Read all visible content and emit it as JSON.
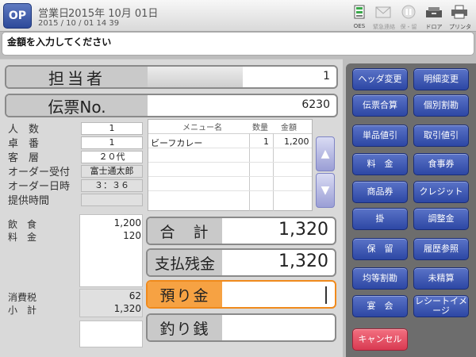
{
  "header": {
    "op_label": "OP",
    "biz_day_label": "営業日",
    "biz_date": "2015年 10月 01日",
    "clock": "2015 / 10 / 01  14  39",
    "status_icons": [
      {
        "name": "oes-icon",
        "label": "OES"
      },
      {
        "name": "mail-icon",
        "label": "緊急連絡"
      },
      {
        "name": "pause-icon",
        "label": "保・留"
      },
      {
        "name": "drawer-icon",
        "label": "ドロア"
      },
      {
        "name": "printer-icon",
        "label": "プリンタ"
      }
    ]
  },
  "message": "金額を入力してください",
  "staff": {
    "label": "担当者",
    "value": "1"
  },
  "slip": {
    "label": "伝票No.",
    "value": "6230"
  },
  "info": [
    {
      "label": "人　数",
      "value": "1"
    },
    {
      "label": "卓　番",
      "value": "1"
    },
    {
      "label": "客　層",
      "value": "２０代"
    },
    {
      "label": "オーダー受付",
      "value": "富士通太郎"
    },
    {
      "label": "オーダー日時",
      "value": "３：３６"
    },
    {
      "label": "提供時間",
      "value": ""
    }
  ],
  "items_table": {
    "headers": [
      "メニュー名",
      "数量",
      "金額"
    ],
    "rows": [
      {
        "name": "ビーフカレー",
        "qty": "1",
        "amount": "1,200"
      }
    ]
  },
  "summary": {
    "food_label": "飲　食",
    "food_value": "1,200",
    "fee_label": "料　金",
    "fee_value": "120",
    "tax_label": "消費税",
    "tax_value": "62",
    "subtotal_label": "小　計",
    "subtotal_value": "1,320"
  },
  "totals": {
    "total_label": "合　計",
    "total_value": "1,320",
    "balance_label": "支払残金",
    "balance_value": "1,320",
    "deposit_label": "預り金",
    "deposit_value": "",
    "change_label": "釣り銭",
    "change_value": ""
  },
  "buttons": [
    [
      "ヘッダ変更",
      "明細変更"
    ],
    [
      "伝票合算",
      "個別割勘"
    ],
    [
      "単品値引",
      "取引値引"
    ],
    [
      "料　金",
      "食事券"
    ],
    [
      "商品券",
      "クレジット"
    ],
    [
      "掛",
      "調整金"
    ],
    [
      "保　留",
      "履歴参照"
    ],
    [
      "均等割勘",
      "未精算"
    ],
    [
      "宴　会",
      "レシートイメージ"
    ]
  ],
  "cancel_label": "キャンセル",
  "colors": {
    "function_button": "#3a55b3",
    "cancel_button": "#e5475f",
    "active_field": "#f08a1c"
  }
}
